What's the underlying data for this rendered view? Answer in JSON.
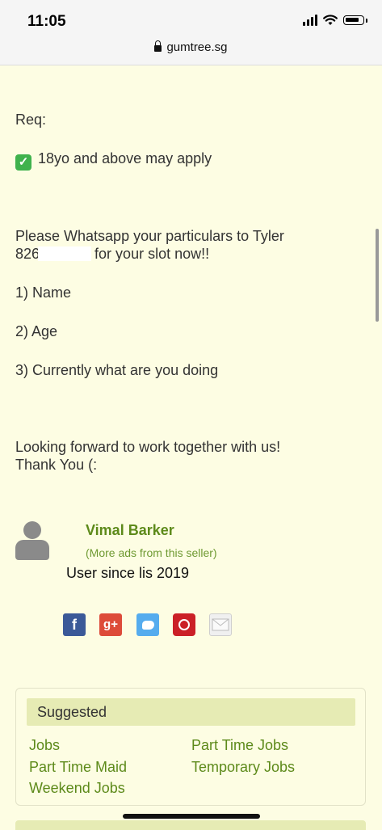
{
  "status": {
    "time": "11:05",
    "url": "gumtree.sg"
  },
  "content": {
    "req_label": "Req:",
    "req_item": "18yo and above may apply",
    "whatsapp_line1": "Please Whatsapp your particulars to Tyler",
    "phone_prefix": "826",
    "whatsapp_line2_suffix": "for your slot now!!",
    "item_name": "1) Name",
    "item_age": "2) Age",
    "item_doing": "3) Currently what are you doing",
    "closing_line1": "Looking forward to work together with us!",
    "closing_line2": "Thank You (:"
  },
  "seller": {
    "name": "Vimal Barker",
    "more_ads": "(More ads from this seller)",
    "since": "User since lis 2019"
  },
  "share": {
    "facebook_glyph": "f",
    "googleplus_glyph": "g+"
  },
  "suggested": {
    "title": "Suggested",
    "links": [
      "Jobs",
      "Part Time Jobs",
      "Part Time Maid",
      "Temporary Jobs",
      "Weekend Jobs"
    ]
  },
  "icons": [
    "lock-icon",
    "check-icon",
    "avatar-icon",
    "facebook-icon",
    "google-plus-icon",
    "twitter-icon",
    "pinterest-icon",
    "mail-icon"
  ],
  "colors": {
    "background": "#fdfde3",
    "link_green": "#5d8a1a",
    "suggested_header": "#e6ebb4"
  }
}
